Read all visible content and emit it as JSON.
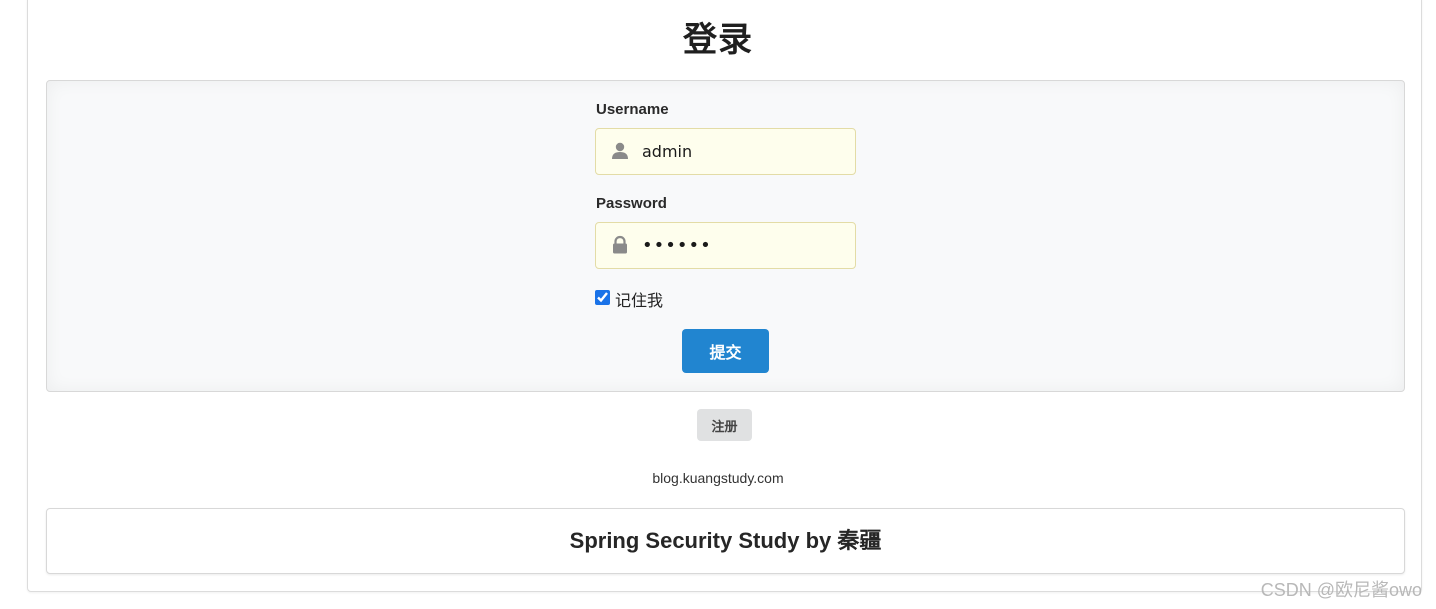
{
  "page": {
    "title": "登录"
  },
  "form": {
    "username_label": "Username",
    "username_value": "admin",
    "password_label": "Password",
    "password_value": "••••••",
    "remember_label": "记住我",
    "remember_checked": true,
    "submit_label": "提交"
  },
  "register_label": "注册",
  "site_link": "blog.kuangstudy.com",
  "footer": {
    "text": "Spring Security Study by 秦疆"
  },
  "watermark": "CSDN @欧尼酱owo",
  "icons": {
    "username": "user-icon",
    "password": "lock-icon"
  },
  "colors": {
    "submit_button": "#2185d0",
    "register_button": "#e0e1e2",
    "input_background": "#fefeed",
    "panel_background": "#f8f9fa"
  }
}
